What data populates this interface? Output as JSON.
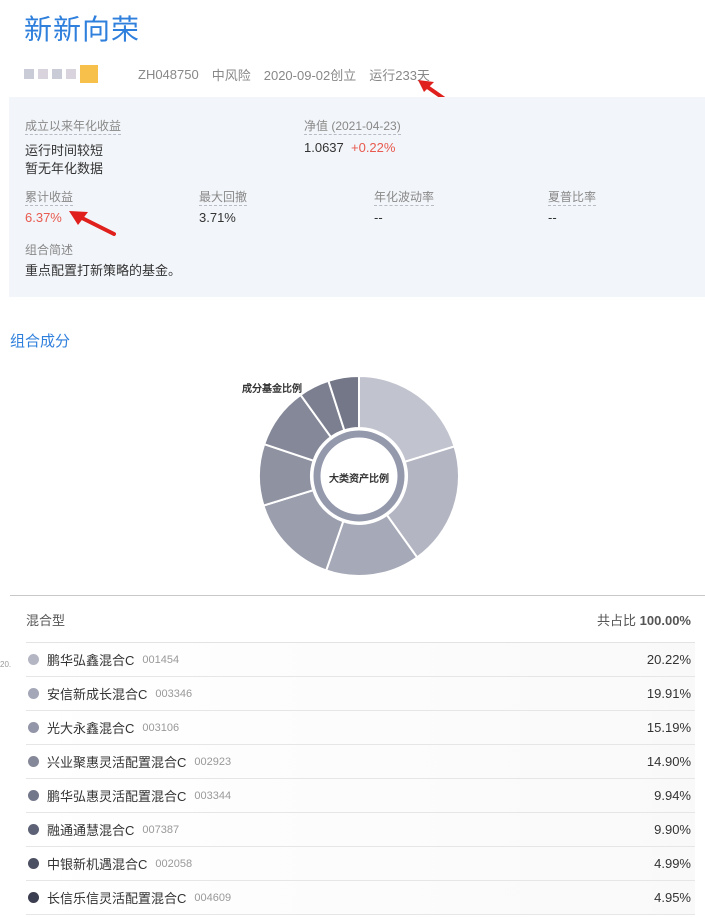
{
  "header": {
    "title": "新新向荣",
    "code": "ZH048750",
    "risk": "中风险",
    "created": "2020-09-02创立",
    "running": "运行233天"
  },
  "stats": {
    "annualized": {
      "label": "成立以来年化收益",
      "line1": "运行时间较短",
      "line2": "暂无年化数据"
    },
    "nav": {
      "label": "净值 (2021-04-23)",
      "value": "1.0637",
      "change": "+0.22%"
    },
    "cumulative": {
      "label": "累计收益",
      "value": "6.37%"
    },
    "drawdown": {
      "label": "最大回撤",
      "value": "3.71%"
    },
    "volatility": {
      "label": "年化波动率",
      "value": "--"
    },
    "sharpe": {
      "label": "夏普比率",
      "value": "--"
    },
    "desc": {
      "label": "组合简述",
      "value": "重点配置打新策略的基金。"
    }
  },
  "composition": {
    "title": "组合成分",
    "outer_label": "成分基金比例",
    "inner_label": "大类资产比例"
  },
  "list": {
    "category": "混合型",
    "total_label": "共占比",
    "total_value": "100.00%",
    "side_mark": "20.",
    "funds": [
      {
        "name": "鹏华弘鑫混合C",
        "code": "001454",
        "pct": "20.22%",
        "value": 20.22,
        "color": "#b4b6c4"
      },
      {
        "name": "安信新成长混合C",
        "code": "003346",
        "pct": "19.91%",
        "value": 19.91,
        "color": "#a4a7b7"
      },
      {
        "name": "光大永鑫混合C",
        "code": "003106",
        "pct": "15.19%",
        "value": 15.19,
        "color": "#9396a8"
      },
      {
        "name": "兴业聚惠灵活配置混合C",
        "code": "002923",
        "pct": "14.90%",
        "value": 14.9,
        "color": "#858899"
      },
      {
        "name": "鹏华弘惠灵活配置混合C",
        "code": "003344",
        "pct": "9.94%",
        "value": 9.94,
        "color": "#73778a"
      },
      {
        "name": "融通通慧混合C",
        "code": "007387",
        "pct": "9.90%",
        "value": 9.9,
        "color": "#5e6276"
      },
      {
        "name": "中银新机遇混合C",
        "code": "002058",
        "pct": "4.99%",
        "value": 4.99,
        "color": "#4c5063"
      },
      {
        "name": "长信乐信灵活配置混合C",
        "code": "004609",
        "pct": "4.95%",
        "value": 4.95,
        "color": "#3b3e50"
      }
    ]
  },
  "chart_data": {
    "type": "pie",
    "title": "",
    "outer_ring": "成分基金比例",
    "inner_ring": "大类资产比例",
    "categories": [
      "鹏华弘鑫混合C",
      "安信新成长混合C",
      "光大永鑫混合C",
      "兴业聚惠灵活配置混合C",
      "鹏华弘惠灵活配置混合C",
      "融通通慧混合C",
      "中银新机遇混合C",
      "长信乐信灵活配置混合C"
    ],
    "values": [
      20.22,
      19.91,
      15.19,
      14.9,
      9.94,
      9.9,
      4.99,
      4.95
    ],
    "slice_colors": [
      "#c1c3cf",
      "#b3b5c2",
      "#a6a9b7",
      "#9b9eac",
      "#8f92a1",
      "#858898",
      "#7c7f8f",
      "#737788"
    ],
    "inner_color": "#9499ac"
  }
}
